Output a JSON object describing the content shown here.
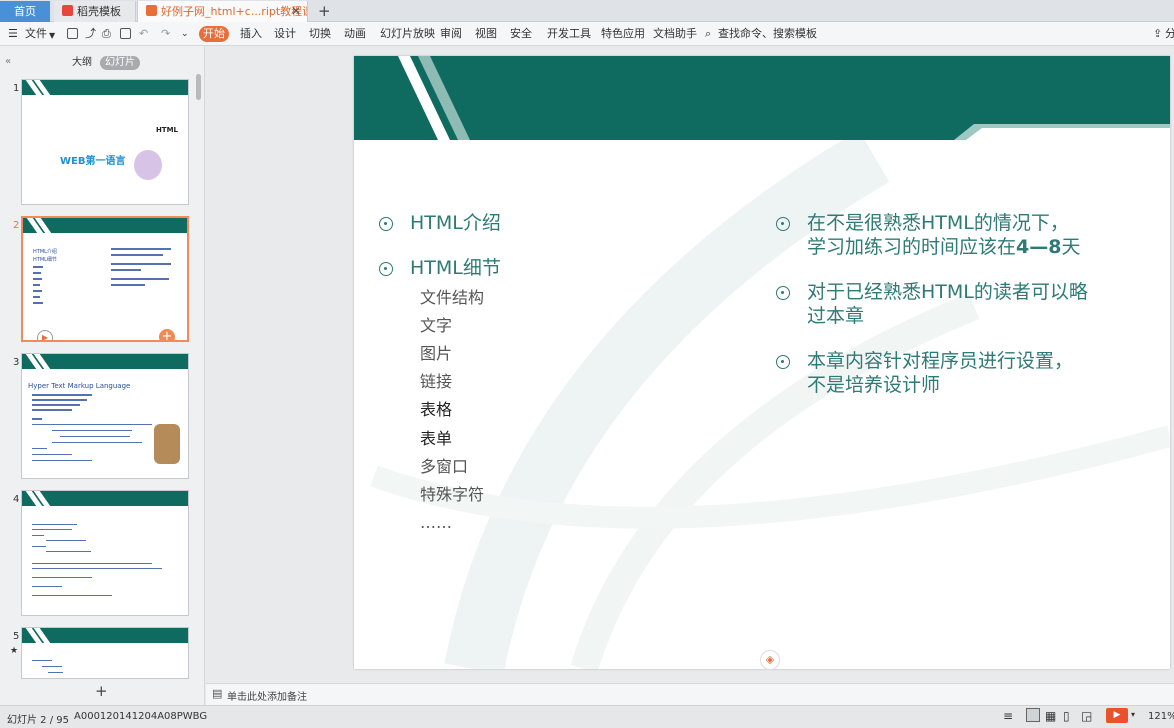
{
  "tabs": {
    "home": "首页",
    "draft": "稻壳模板",
    "doc": "好例子网_html+c...ript教程课件ppt",
    "add": "+"
  },
  "menubar": {
    "file": "文件",
    "start": "开始",
    "insert": "插入",
    "design": "设计",
    "transition": "切换",
    "animation": "动画",
    "slideshow": "幻灯片放映",
    "review": "审阅",
    "view": "视图",
    "security": "安全",
    "devtools": "开发工具",
    "special": "特色应用",
    "assistant": "文档助手",
    "search": "查找命令、搜索模板",
    "share": "分"
  },
  "leftpanel": {
    "outline_tab": "大纲",
    "slides_tab": "幻灯片",
    "thumbnails": [
      {
        "num": "1",
        "title_html": "HTML",
        "title_main": "WEB第一语言"
      },
      {
        "num": "2",
        "items": [
          "HTML介绍",
          "HTML细节"
        ]
      },
      {
        "num": "3",
        "heading": "Hyper Text Markup Language"
      },
      {
        "num": "4"
      },
      {
        "num": "5"
      }
    ],
    "add_slide": "+"
  },
  "slide": {
    "left_bullets": [
      {
        "text": "HTML介绍"
      },
      {
        "text": "HTML细节"
      }
    ],
    "sub_items": [
      {
        "text": "文件结构",
        "dark": false
      },
      {
        "text": "文字",
        "dark": false
      },
      {
        "text": "图片",
        "dark": false
      },
      {
        "text": "链接",
        "dark": false
      },
      {
        "text": "表格",
        "dark": true
      },
      {
        "text": "表单",
        "dark": true
      },
      {
        "text": "多窗口",
        "dark": false
      },
      {
        "text": "特殊字符",
        "dark": false
      },
      {
        "text": "……",
        "dark": false
      }
    ],
    "right_bullets": [
      {
        "line1": "在不是很熟悉HTML的情况下，",
        "line2a": "学习加练习的时间应该在",
        "line2b": "4—8",
        "line2c": "天"
      },
      {
        "line1": "对于已经熟悉HTML的读者可以略",
        "line2a": "过本章",
        "line2b": "",
        "line2c": ""
      },
      {
        "line1": "本章内容针对程序员进行设置，",
        "line2a": "不是培养设计师",
        "line2b": "",
        "line2c": ""
      }
    ]
  },
  "notes": {
    "placeholder": "单击此处添加备注"
  },
  "statusbar": {
    "slide_index": "幻灯片 2 / 95",
    "template_id": "A000120141204A08PWBG",
    "zoom": "121%"
  },
  "colors": {
    "accent_orange": "#e86f3c",
    "slide_teal": "#0f6b60",
    "text_teal": "#2e7a75"
  }
}
